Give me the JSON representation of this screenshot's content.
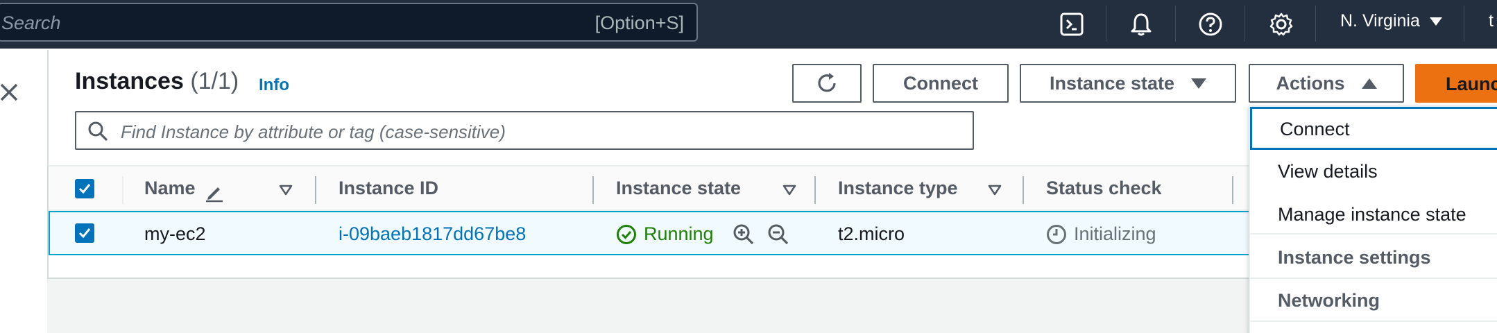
{
  "topbar": {
    "search_placeholder": "Search",
    "search_shortcut": "[Option+S]",
    "region": "N. Virginia",
    "user_partial": "t"
  },
  "panel": {
    "title": "Instances",
    "count": "(1/1)",
    "info": "Info",
    "buttons": {
      "connect": "Connect",
      "instance_state": "Instance state",
      "actions": "Actions",
      "launch": "Launch instances"
    },
    "filter_placeholder": "Find Instance by attribute or tag (case-sensitive)"
  },
  "table": {
    "columns": [
      "Name",
      "Instance ID",
      "Instance state",
      "Instance type",
      "Status check"
    ],
    "rows": [
      {
        "name": "my-ec2",
        "instance_id": "i-09baeb1817dd67be8",
        "state": "Running",
        "type": "t2.micro",
        "status_check": "Initializing"
      }
    ]
  },
  "actions_menu": {
    "items": [
      {
        "label": "Connect",
        "kind": "item"
      },
      {
        "label": "View details",
        "kind": "item"
      },
      {
        "label": "Manage instance state",
        "kind": "item"
      },
      {
        "label": "Instance settings",
        "kind": "group"
      },
      {
        "label": "Networking",
        "kind": "group"
      }
    ]
  },
  "colors": {
    "nav_bg": "#232f3e",
    "accent": "#0073bb",
    "running": "#1d8102",
    "launch": "#ec7211"
  }
}
